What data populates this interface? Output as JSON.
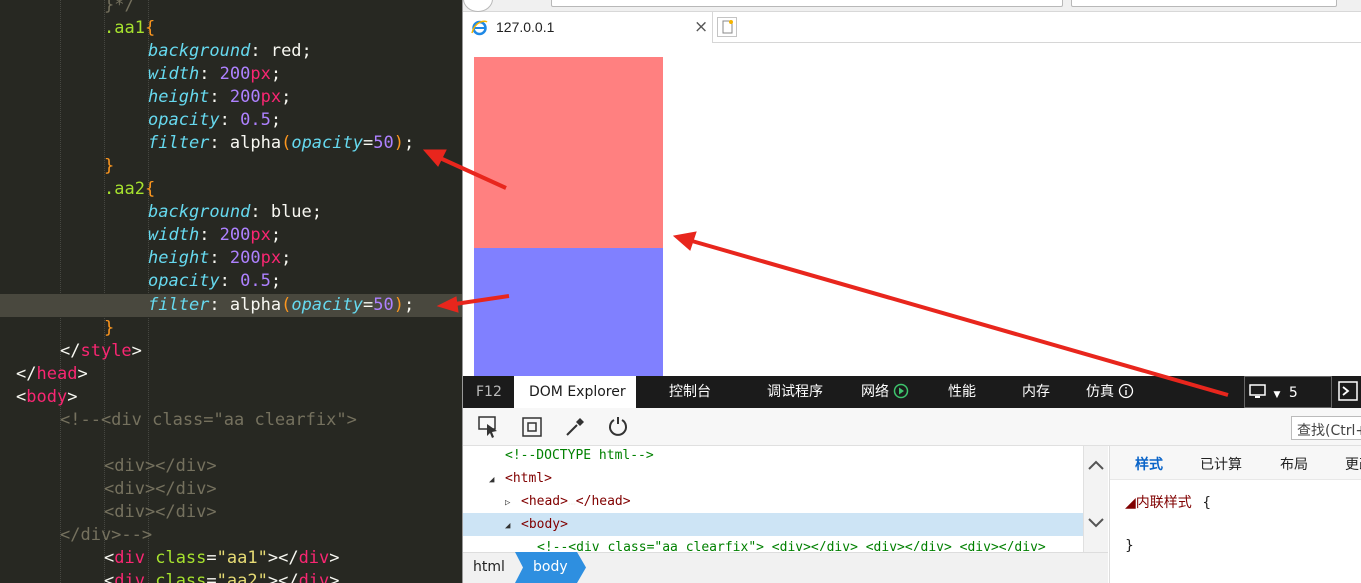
{
  "editor": {
    "lines": [
      {
        "indent": 2,
        "parts": [
          [
            "cmt",
            "}*/"
          ]
        ]
      },
      {
        "indent": 2,
        "parts": [
          [
            "sel",
            ".aa1"
          ],
          [
            "brace",
            "{"
          ]
        ]
      },
      {
        "indent": 3,
        "parts": [
          [
            "prop",
            "background"
          ],
          [
            "pl",
            ": red;"
          ]
        ]
      },
      {
        "indent": 3,
        "parts": [
          [
            "prop",
            "width"
          ],
          [
            "pl",
            ": "
          ],
          [
            "num",
            "200"
          ],
          [
            "unit",
            "px"
          ],
          [
            "pl",
            ";"
          ]
        ]
      },
      {
        "indent": 3,
        "parts": [
          [
            "prop",
            "height"
          ],
          [
            "pl",
            ": "
          ],
          [
            "num",
            "200"
          ],
          [
            "unit",
            "px"
          ],
          [
            "pl",
            ";"
          ]
        ]
      },
      {
        "indent": 3,
        "parts": [
          [
            "prop",
            "opacity"
          ],
          [
            "pl",
            ": "
          ],
          [
            "num",
            "0.5"
          ],
          [
            "pl",
            ";"
          ]
        ]
      },
      {
        "indent": 3,
        "parts": [
          [
            "prop",
            "filter"
          ],
          [
            "pl",
            ": alpha"
          ],
          [
            "brace",
            "("
          ],
          [
            "prop",
            "opacity"
          ],
          [
            "pl",
            "="
          ],
          [
            "num",
            "50"
          ],
          [
            "brace",
            ")"
          ],
          [
            "pl",
            ";"
          ]
        ]
      },
      {
        "indent": 2,
        "parts": [
          [
            "brace",
            "}"
          ]
        ]
      },
      {
        "indent": 2,
        "parts": [
          [
            "sel",
            ".aa2"
          ],
          [
            "brace",
            "{"
          ]
        ]
      },
      {
        "indent": 3,
        "parts": [
          [
            "prop",
            "background"
          ],
          [
            "pl",
            ": blue;"
          ]
        ]
      },
      {
        "indent": 3,
        "parts": [
          [
            "prop",
            "width"
          ],
          [
            "pl",
            ": "
          ],
          [
            "num",
            "200"
          ],
          [
            "unit",
            "px"
          ],
          [
            "pl",
            ";"
          ]
        ]
      },
      {
        "indent": 3,
        "parts": [
          [
            "prop",
            "height"
          ],
          [
            "pl",
            ": "
          ],
          [
            "num",
            "200"
          ],
          [
            "unit",
            "px"
          ],
          [
            "pl",
            ";"
          ]
        ]
      },
      {
        "indent": 3,
        "parts": [
          [
            "prop",
            "opacity"
          ],
          [
            "pl",
            ": "
          ],
          [
            "num",
            "0.5"
          ],
          [
            "pl",
            ";"
          ]
        ]
      },
      {
        "indent": 3,
        "highlight": true,
        "parts": [
          [
            "prop",
            "filter"
          ],
          [
            "pl",
            ": alpha"
          ],
          [
            "brace",
            "("
          ],
          [
            "prop",
            "opacity"
          ],
          [
            "pl",
            "="
          ],
          [
            "num",
            "50"
          ],
          [
            "brace",
            ")"
          ],
          [
            "pl",
            ";"
          ]
        ]
      },
      {
        "indent": 2,
        "parts": [
          [
            "brace",
            "}"
          ]
        ]
      },
      {
        "indent": 1,
        "parts": [
          [
            "pl",
            "</"
          ],
          [
            "tag",
            "style"
          ],
          [
            "pl",
            ">"
          ]
        ]
      },
      {
        "indent": 0,
        "parts": [
          [
            "pl",
            "</"
          ],
          [
            "tag",
            "head"
          ],
          [
            "pl",
            ">"
          ]
        ]
      },
      {
        "indent": 0,
        "parts": [
          [
            "pl",
            "<"
          ],
          [
            "tag",
            "body"
          ],
          [
            "pl",
            ">"
          ]
        ]
      },
      {
        "indent": 1,
        "parts": [
          [
            "cmt",
            "<!--<div class=\"aa clearfix\">"
          ]
        ]
      },
      {
        "indent": 0,
        "parts": []
      },
      {
        "indent": 2,
        "parts": [
          [
            "cmt",
            "<div></div>"
          ]
        ]
      },
      {
        "indent": 2,
        "parts": [
          [
            "cmt",
            "<div></div>"
          ]
        ]
      },
      {
        "indent": 2,
        "parts": [
          [
            "cmt",
            "<div></div>"
          ]
        ]
      },
      {
        "indent": 1,
        "parts": [
          [
            "cmt",
            "</div>-->"
          ]
        ]
      },
      {
        "indent": 2,
        "parts": [
          [
            "pl",
            "<"
          ],
          [
            "tag",
            "div"
          ],
          [
            "pl",
            " "
          ],
          [
            "sel",
            "class"
          ],
          [
            "pl",
            "="
          ],
          [
            "str",
            "\"aa1\""
          ],
          [
            "pl",
            "></"
          ],
          [
            "tag",
            "div"
          ],
          [
            "pl",
            ">"
          ]
        ]
      },
      {
        "indent": 2,
        "parts": [
          [
            "pl",
            "<"
          ],
          [
            "tag",
            "div"
          ],
          [
            "pl",
            " "
          ],
          [
            "sel",
            "class"
          ],
          [
            "pl",
            "="
          ],
          [
            "str",
            "\"aa2\""
          ],
          [
            "pl",
            "></"
          ],
          [
            "tag",
            "div"
          ],
          [
            "pl",
            ">"
          ]
        ]
      }
    ]
  },
  "browser": {
    "tab_title": "127.0.0.1",
    "tab_close": "×",
    "boxes": [
      {
        "class": "aa1",
        "color": "#ff8080"
      },
      {
        "class": "aa2",
        "color": "#8080ff"
      }
    ]
  },
  "devtools": {
    "f12": "F12",
    "tabs": [
      "DOM Explorer",
      "控制台",
      "调试程序",
      "网络",
      "性能",
      "内存",
      "仿真"
    ],
    "active_tab": "DOM Explorer",
    "emulation_target": "5",
    "find_placeholder": "查找(Ctrl+",
    "dom_lines": [
      {
        "indent": 0,
        "arrow": "",
        "parts": [
          [
            "dt-cmt",
            "<!--DOCTYPE html-->"
          ]
        ]
      },
      {
        "indent": 0,
        "arrow": "◢",
        "parts": [
          [
            "dt-tag",
            "<html>"
          ]
        ]
      },
      {
        "indent": 1,
        "arrow": "▷",
        "parts": [
          [
            "dt-tag",
            "<head>"
          ],
          [
            "pl",
            "…"
          ],
          [
            "dt-tag",
            "</head>"
          ]
        ]
      },
      {
        "indent": 1,
        "arrow": "◢",
        "selected": true,
        "parts": [
          [
            "dt-tag",
            "<body>"
          ]
        ]
      },
      {
        "indent": 2,
        "arrow": "",
        "parts": [
          [
            "dt-cmt",
            "<!--<div class=\"aa clearfix\"> <div></div> <div></div> <div></div>"
          ]
        ]
      }
    ],
    "breadcrumb": [
      "html",
      "body"
    ],
    "style_tabs": [
      "样式",
      "已计算",
      "布局",
      "更改"
    ],
    "active_style_tab": "样式",
    "inline_style_label": "◢内联样式",
    "open_brace": "{",
    "close_brace": "}"
  },
  "colors": {
    "editor_bg": "#272822",
    "devtools_bar": "#1b1b1b",
    "selected_row": "#cde4f5",
    "breadcrumb_active": "#2e8fe0",
    "arrow_red": "#e8261d"
  }
}
